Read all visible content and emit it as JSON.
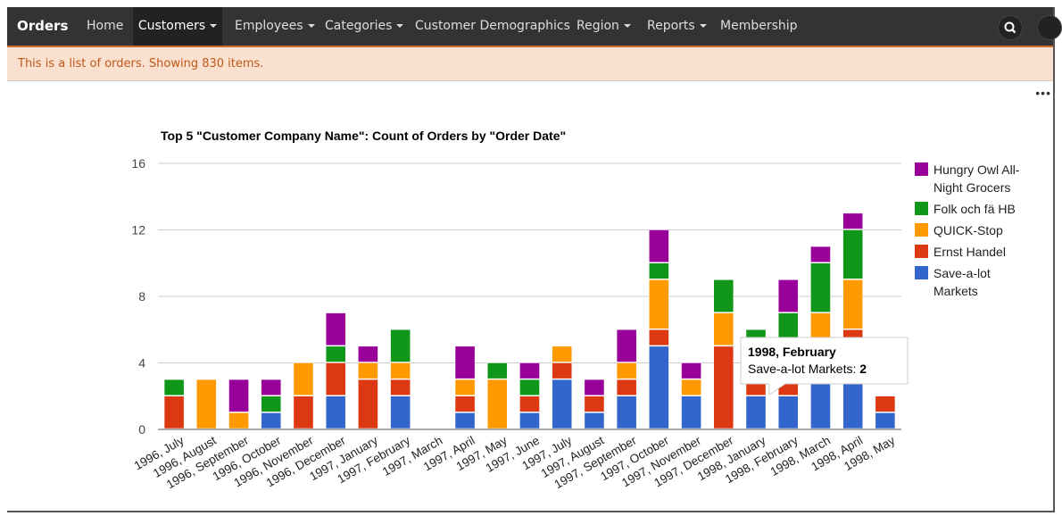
{
  "nav": {
    "brand": "Orders",
    "items": [
      {
        "label": "Home",
        "caret": false
      },
      {
        "label": "Customers",
        "caret": true,
        "active": true
      },
      {
        "label": "Employees",
        "caret": true
      },
      {
        "label": "Categories",
        "caret": true
      },
      {
        "label": "Customer Demographics",
        "caret": false
      },
      {
        "label": "Region",
        "caret": true
      },
      {
        "label": "Reports",
        "caret": true
      },
      {
        "label": "Membership",
        "caret": false
      }
    ]
  },
  "banner": "This is a list of orders. Showing 830 items.",
  "more_label": "•••",
  "tooltip": {
    "title": "1998, February",
    "series": "Save-a-lot Markets:",
    "value": "2"
  },
  "chart_data": {
    "type": "bar",
    "stacked": true,
    "title": "Top 5 \"Customer Company Name\": Count of Orders by \"Order Date\"",
    "xlabel": "",
    "ylabel": "",
    "ylim": [
      0,
      16
    ],
    "yticks": [
      0,
      4,
      8,
      12,
      16
    ],
    "grid": true,
    "legend": "right",
    "categories": [
      "1996, July",
      "1996, August",
      "1996, September",
      "1996, October",
      "1996, November",
      "1996, December",
      "1997, January",
      "1997, February",
      "1997, March",
      "1997, April",
      "1997, May",
      "1997, June",
      "1997, July",
      "1997, August",
      "1997, September",
      "1997, October",
      "1997, November",
      "1997, December",
      "1998, January",
      "1998, February",
      "1998, March",
      "1998, April",
      "1998, May"
    ],
    "series": [
      {
        "name": "Save-a-lot Markets",
        "color": "#3366cc",
        "values": [
          0,
          0,
          0,
          1,
          0,
          2,
          0,
          2,
          0,
          1,
          0,
          1,
          3,
          1,
          2,
          5,
          2,
          0,
          2,
          2,
          5,
          5,
          1
        ]
      },
      {
        "name": "Ernst Handel",
        "color": "#dc3912",
        "values": [
          2,
          0,
          0,
          0,
          2,
          2,
          3,
          1,
          0,
          1,
          0,
          1,
          1,
          1,
          1,
          1,
          0,
          5,
          3,
          2,
          0,
          1,
          1
        ]
      },
      {
        "name": "QUICK-Stop",
        "color": "#ff9900",
        "values": [
          0,
          3,
          1,
          0,
          2,
          0,
          1,
          1,
          0,
          1,
          3,
          0,
          1,
          0,
          1,
          3,
          1,
          2,
          0,
          0,
          2,
          3,
          0
        ]
      },
      {
        "name": "Folk och fä HB",
        "color": "#109618",
        "values": [
          1,
          0,
          0,
          1,
          0,
          1,
          0,
          2,
          0,
          0,
          1,
          1,
          0,
          0,
          0,
          1,
          0,
          2,
          1,
          3,
          3,
          3,
          0
        ]
      },
      {
        "name": "Hungry Owl All-Night Grocers",
        "color": "#990099",
        "values": [
          0,
          0,
          2,
          1,
          0,
          2,
          1,
          0,
          0,
          2,
          0,
          1,
          0,
          1,
          2,
          2,
          1,
          0,
          0,
          2,
          1,
          1,
          0
        ]
      }
    ],
    "legend_order": [
      4,
      3,
      2,
      1,
      0
    ],
    "legend_lines": [
      [
        "Hungry Owl All-",
        "Night Grocers"
      ],
      [
        "Folk och fä HB"
      ],
      [
        "QUICK-Stop"
      ],
      [
        "Ernst Handel"
      ],
      [
        "Save-a-lot",
        "Markets"
      ]
    ]
  }
}
